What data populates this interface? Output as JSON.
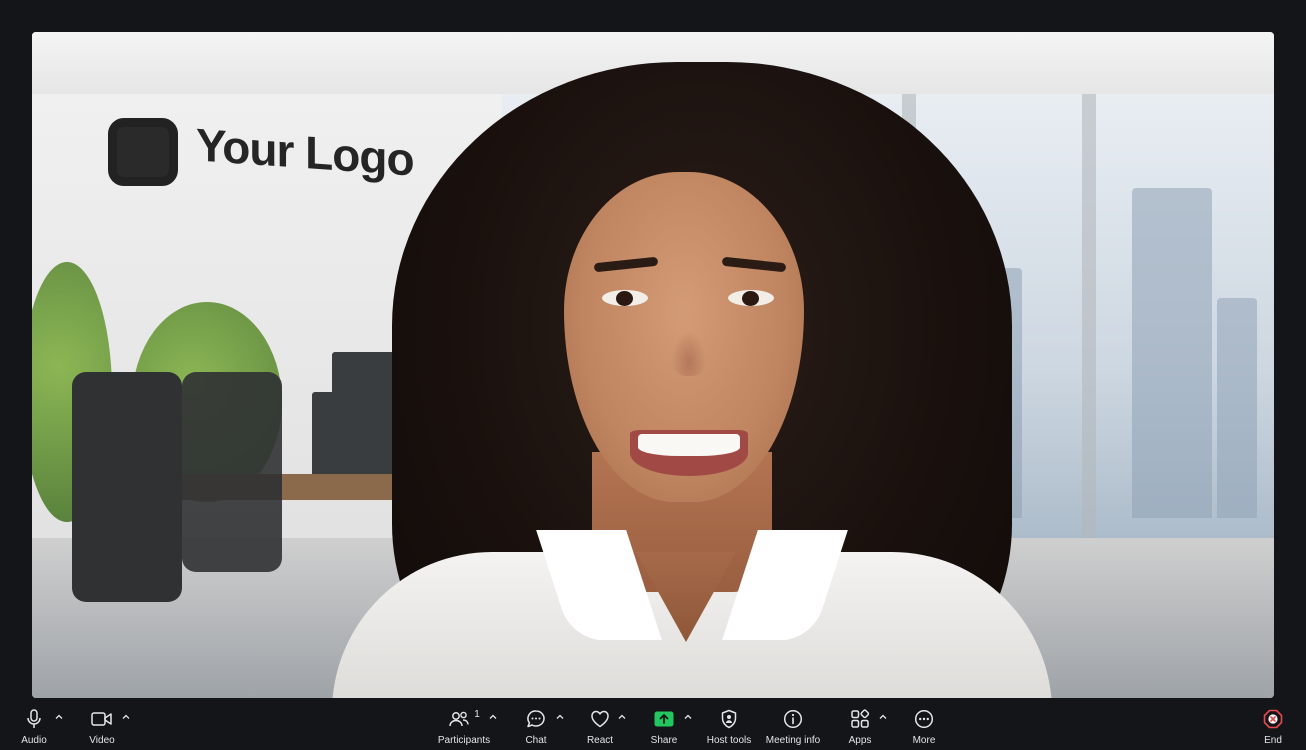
{
  "video": {
    "background_logo_text": "Your Logo"
  },
  "toolbar": {
    "audio_label": "Audio",
    "video_label": "Video",
    "participants_label": "Participants",
    "participants_count": "1",
    "chat_label": "Chat",
    "react_label": "React",
    "share_label": "Share",
    "host_tools_label": "Host tools",
    "meeting_info_label": "Meeting info",
    "apps_label": "Apps",
    "more_label": "More",
    "end_label": "End"
  },
  "colors": {
    "toolbar_bg": "#141519",
    "share_accent": "#22c55e",
    "end_accent": "#e5484d",
    "icon": "#e6e6e8"
  },
  "icons": {
    "audio": "microphone-icon",
    "video": "video-camera-icon",
    "participants": "people-icon",
    "chat": "chat-bubble-icon",
    "react": "heart-icon",
    "share": "share-arrow-icon",
    "host_tools": "shield-icon",
    "meeting_info": "info-icon",
    "apps": "apps-grid-icon",
    "more": "more-dots-icon",
    "end": "end-x-icon"
  }
}
